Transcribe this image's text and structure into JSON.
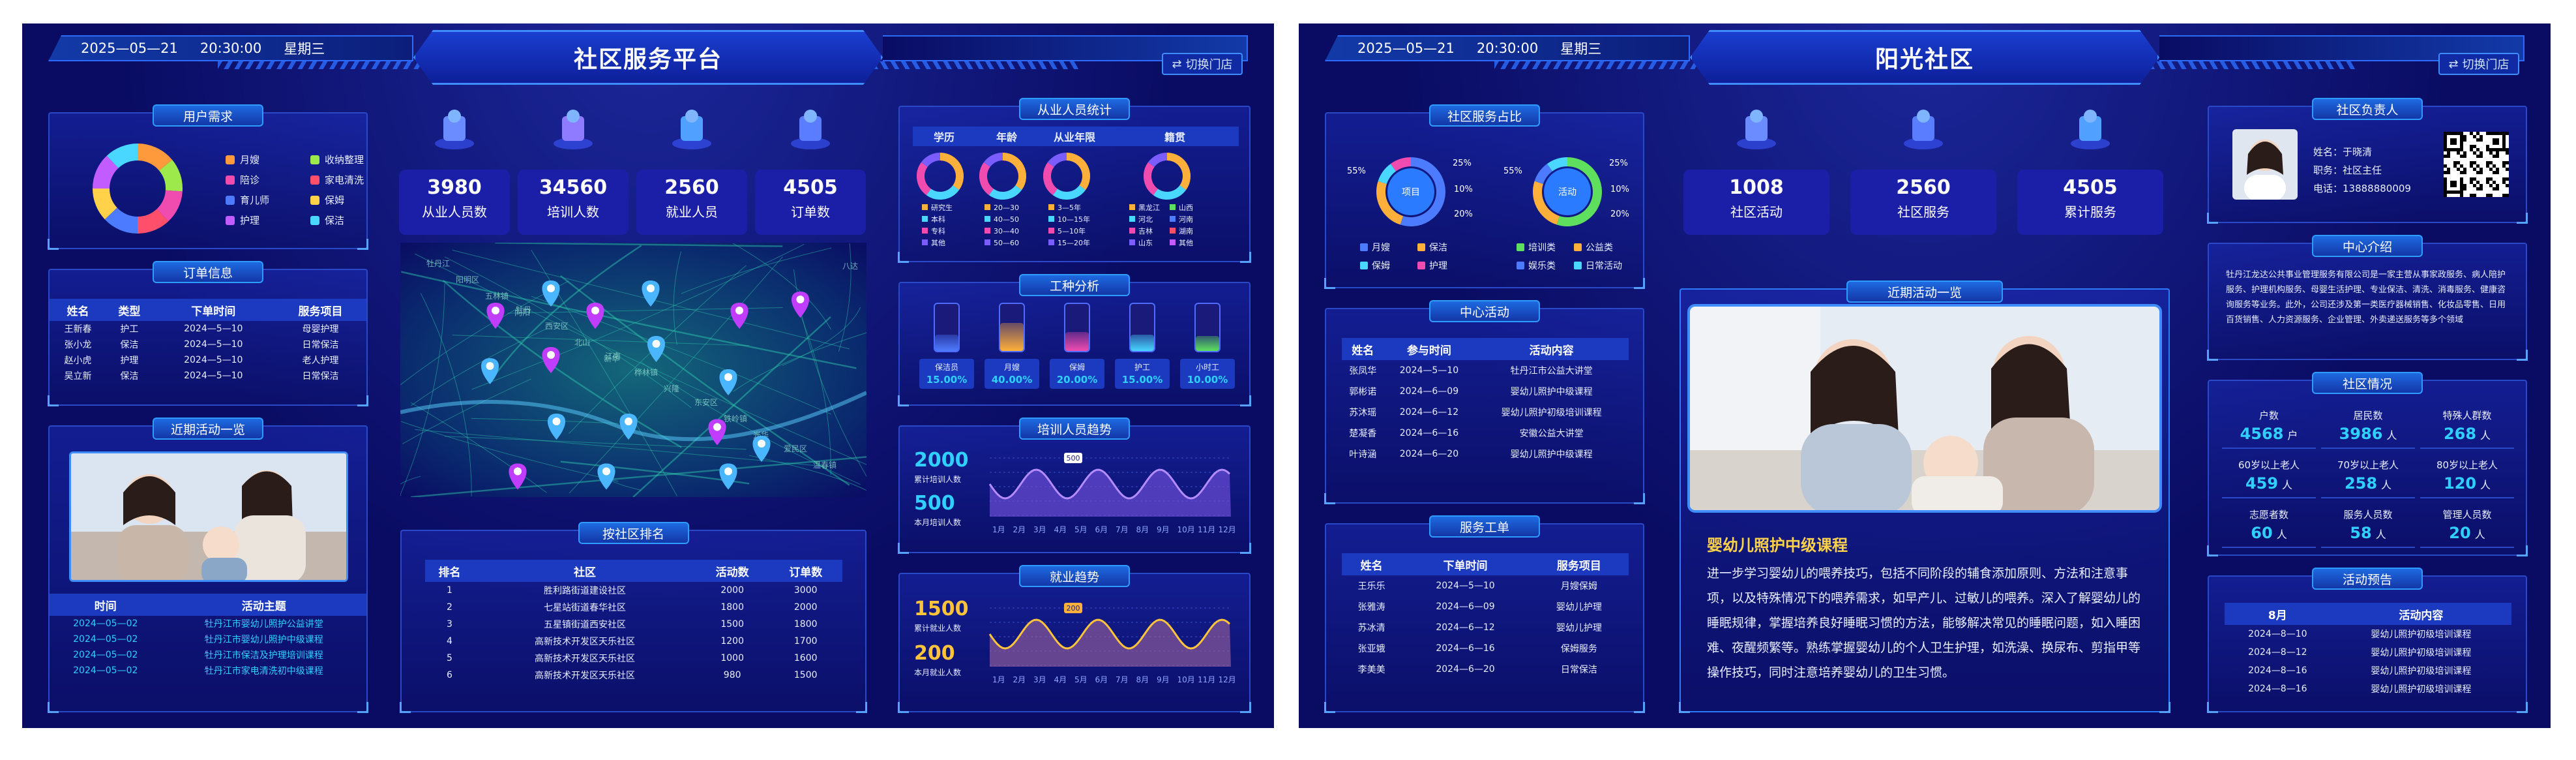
{
  "left": {
    "date": "2025—05—21",
    "time": "20:30:00",
    "weekday": "星期三",
    "title": "社区服务平台",
    "switch_label": "切换门店",
    "user_demand": {
      "title": "用户需求",
      "legend": [
        "月嫂",
        "收纳整理",
        "陪诊",
        "家电清洗",
        "育儿师",
        "保姆",
        "护理",
        "保洁"
      ],
      "colors": [
        "#ff9a3c",
        "#9de84a",
        "#f04cb0",
        "#ff4f6a",
        "#4d7bff",
        "#ffd24a",
        "#c25cff",
        "#49d7ff"
      ]
    },
    "orders": {
      "title": "订单信息",
      "headers": [
        "姓名",
        "类型",
        "下单时间",
        "服务项目"
      ],
      "rows": [
        [
          "王新春",
          "护工",
          "2024—5—10",
          "母婴护理"
        ],
        [
          "张小龙",
          "保洁",
          "2024—5—10",
          "日常保洁"
        ],
        [
          "赵小虎",
          "护理",
          "2024—5—10",
          "老人护理"
        ],
        [
          "吴立新",
          "保洁",
          "2024—5—10",
          "日常保洁"
        ]
      ]
    },
    "recent": {
      "title": "近期活动一览",
      "headers": [
        "时间",
        "活动主题"
      ],
      "rows": [
        [
          "2024—05—02",
          "牡丹江市婴幼儿照护公益讲堂"
        ],
        [
          "2024—05—02",
          "牡丹江市婴幼儿照护中级课程"
        ],
        [
          "2024—05—02",
          "牡丹江市保洁及护理培训课程"
        ],
        [
          "2024—05—02",
          "牡丹江市家电清洗初中级课程"
        ]
      ]
    },
    "stats": [
      {
        "value": "3980",
        "label": "从业人员数"
      },
      {
        "value": "34560",
        "label": "培训人数"
      },
      {
        "value": "2560",
        "label": "就业人员"
      },
      {
        "value": "4505",
        "label": "订单数"
      }
    ],
    "ranking": {
      "title": "按社区排名",
      "headers": [
        "排名",
        "社区",
        "活动数",
        "订单数"
      ],
      "rows": [
        [
          "1",
          "胜利路街道建设社区",
          "2000",
          "3000"
        ],
        [
          "2",
          "七星站街道春华社区",
          "1800",
          "2000"
        ],
        [
          "3",
          "五星镇街道西安社区",
          "1500",
          "1800"
        ],
        [
          "4",
          "高新技术开发区天乐社区",
          "1200",
          "1700"
        ],
        [
          "5",
          "高新技术开发区天乐社区",
          "1000",
          "1600"
        ],
        [
          "6",
          "高新技术开发区天乐社区",
          "980",
          "1500"
        ]
      ]
    },
    "staff_stats": {
      "title": "从业人员统计",
      "tabs": [
        "学历",
        "年龄",
        "从业年限",
        "籍贯"
      ],
      "donut_colors": [
        [
          "#ffb03a",
          "#49d7ff",
          "#f04cb0",
          "#7a5cff"
        ],
        [
          "#ffb03a",
          "#49d7ff",
          "#f04cb0",
          "#7a5cff"
        ],
        [
          "#ffb03a",
          "#49d7ff",
          "#f04cb0",
          "#7a5cff"
        ],
        [
          "#ffb03a",
          "#49d7ff",
          "#f04cb0",
          "#7a5cff"
        ]
      ],
      "legends": [
        [
          "研究生",
          "本科",
          "专科",
          "其他"
        ],
        [
          "20—30",
          "40—50",
          "30—40",
          "50—60"
        ],
        [
          "3—5年",
          "10—15年",
          "5—10年",
          "15—20年"
        ],
        [
          "黑龙江",
          "河北",
          "吉林",
          "山东",
          "山西",
          "河南",
          "湖南",
          "其他"
        ]
      ]
    },
    "work_types": {
      "title": "工种分析",
      "items": [
        {
          "name": "保洁员",
          "pct": "15.00%",
          "level": 0.15,
          "color": "#4d7bff"
        },
        {
          "name": "月嫂",
          "pct": "40.00%",
          "level": 0.4,
          "color": "#ffb03a"
        },
        {
          "name": "保姆",
          "pct": "20.00%",
          "level": 0.2,
          "color": "#f04cb0"
        },
        {
          "name": "护工",
          "pct": "15.00%",
          "level": 0.15,
          "color": "#49d7ff"
        },
        {
          "name": "小时工",
          "pct": "10.00%",
          "level": 0.1,
          "color": "#5ee05e"
        }
      ]
    },
    "training_trend": {
      "title": "培训人员趋势",
      "total_value": "2000",
      "total_label": "累计培训人数",
      "month_value": "500",
      "month_label": "本月培训人数",
      "tooltip": "500",
      "months": [
        "1月",
        "2月",
        "3月",
        "4月",
        "5月",
        "6月",
        "7月",
        "8月",
        "9月",
        "10月",
        "11月",
        "12月"
      ]
    },
    "employment_trend": {
      "title": "就业趋势",
      "total_value": "1500",
      "total_label": "累计就业人数",
      "month_value": "200",
      "month_label": "本月就业人数",
      "tooltip": "200",
      "months": [
        "1月",
        "2月",
        "3月",
        "4月",
        "5月",
        "6月",
        "7月",
        "8月",
        "9月",
        "10月",
        "11月",
        "12月"
      ]
    },
    "map_labels": [
      "牡丹江",
      "牡丹",
      "江南",
      "东安区",
      "爱民区",
      "阳明区",
      "西安区",
      "桦林镇",
      "铁岭镇",
      "温春镇",
      "五林镇",
      "北山",
      "兴隆",
      "光华",
      "八达",
      "向阳",
      "新华"
    ]
  },
  "right": {
    "date": "2025—05—21",
    "time": "20:30:00",
    "weekday": "星期三",
    "title": "阳光社区",
    "switch_label": "切换门店",
    "share": {
      "title": "社区服务占比",
      "donut1": {
        "center": "项目",
        "labels": [
          "55%",
          "25%",
          "10%",
          "20%"
        ],
        "legend": [
          "月嫂",
          "保洁",
          "保姆",
          "护理"
        ],
        "colors": [
          "#4d7bff",
          "#ffb03a",
          "#49d7ff",
          "#f04cb0"
        ]
      },
      "donut2": {
        "center": "活动",
        "labels": [
          "55%",
          "25%",
          "10%",
          "20%"
        ],
        "legend": [
          "培训类",
          "公益类",
          "娱乐类",
          "日常活动"
        ],
        "colors": [
          "#5ee05e",
          "#ffb03a",
          "#4d7bff",
          "#49d7ff"
        ]
      }
    },
    "stats": [
      {
        "value": "1008",
        "label": "社区活动"
      },
      {
        "value": "2560",
        "label": "社区服务"
      },
      {
        "value": "4505",
        "label": "累计服务"
      }
    ],
    "center_activity": {
      "title": "中心活动",
      "headers": [
        "姓名",
        "参与时间",
        "活动内容"
      ],
      "rows": [
        [
          "张凤华",
          "2024—5—10",
          "牡丹江市公益大讲堂"
        ],
        [
          "郭彬诺",
          "2024—6—09",
          "婴幼儿照护中级课程"
        ],
        [
          "苏沐瑶",
          "2024—6—12",
          "婴幼儿照护初级培训课程"
        ],
        [
          "楚凝香",
          "2024—6—16",
          "安徽公益大讲堂"
        ],
        [
          "叶诗涵",
          "2024—6—20",
          "婴幼儿照护中级课程"
        ]
      ]
    },
    "service_orders": {
      "title": "服务工单",
      "headers": [
        "姓名",
        "下单时间",
        "服务项目"
      ],
      "rows": [
        [
          "王乐乐",
          "2024—5—10",
          "月嫂保姆"
        ],
        [
          "张雅涛",
          "2024—6—09",
          "婴幼儿护理"
        ],
        [
          "苏冰清",
          "2024—6—12",
          "婴幼儿护理"
        ],
        [
          "张亚娥",
          "2024—6—16",
          "保姆服务"
        ],
        [
          "李美美",
          "2024—6—20",
          "日常保洁"
        ]
      ]
    },
    "recent": {
      "title": "近期活动一览",
      "course_title": "婴幼儿照护中级课程",
      "course_text": "进一步学习婴幼儿的喂养技巧，包括不同阶段的辅食添加原则、方法和注意事项，以及特殊情况下的喂养需求，如早产儿、过敏儿的喂养。深入了解婴幼儿的睡眠规律，掌握培养良好睡眠习惯的方法，能够解决常见的睡眠问题，如入睡困难、夜醒频繁等。熟练掌握婴幼儿的个人卫生护理，如洗澡、换尿布、剪指甲等操作技巧，同时注意培养婴幼儿的卫生习惯。"
    },
    "manager": {
      "title": "社区负责人",
      "name": "姓名：于晓清",
      "role": "职务：社区主任",
      "phone": "电话：13888880009"
    },
    "intro": {
      "title": "中心介绍",
      "text": "牡丹江龙达公共事业管理服务有限公司是一家主营从事家政服务、病人陪护服务、护理机构服务、母婴生活护理、专业保洁、清洗、消毒服务、健康咨询服务等业务。此外，公司还涉及第一类医疗器械销售、化妆品零售、日用百货销售、人力资源服务、企业管理、外卖递送服务等多个领域"
    },
    "situation": {
      "title": "社区情况",
      "items": [
        {
          "label": "户数",
          "value": "4568",
          "unit": "户"
        },
        {
          "label": "居民数",
          "value": "3986",
          "unit": "人"
        },
        {
          "label": "特殊人群数",
          "value": "268",
          "unit": "人"
        },
        {
          "label": "60岁以上老人",
          "value": "459",
          "unit": "人"
        },
        {
          "label": "70岁以上老人",
          "value": "258",
          "unit": "人"
        },
        {
          "label": "80岁以上老人",
          "value": "120",
          "unit": "人"
        },
        {
          "label": "志愿者数",
          "value": "60",
          "unit": "人"
        },
        {
          "label": "服务人员数",
          "value": "58",
          "unit": "人"
        },
        {
          "label": "管理人员数",
          "value": "20",
          "unit": "人"
        }
      ]
    },
    "notice": {
      "title": "活动预告",
      "headers": [
        "8月",
        "活动内容"
      ],
      "rows": [
        [
          "2024—8—10",
          "婴幼儿照护初级培训课程"
        ],
        [
          "2024—8—12",
          "婴幼儿照护初级培训课程"
        ],
        [
          "2024—8—16",
          "婴幼儿照护初级培训课程"
        ],
        [
          "2024—8—16",
          "婴幼儿照护初级培训课程"
        ]
      ]
    }
  }
}
